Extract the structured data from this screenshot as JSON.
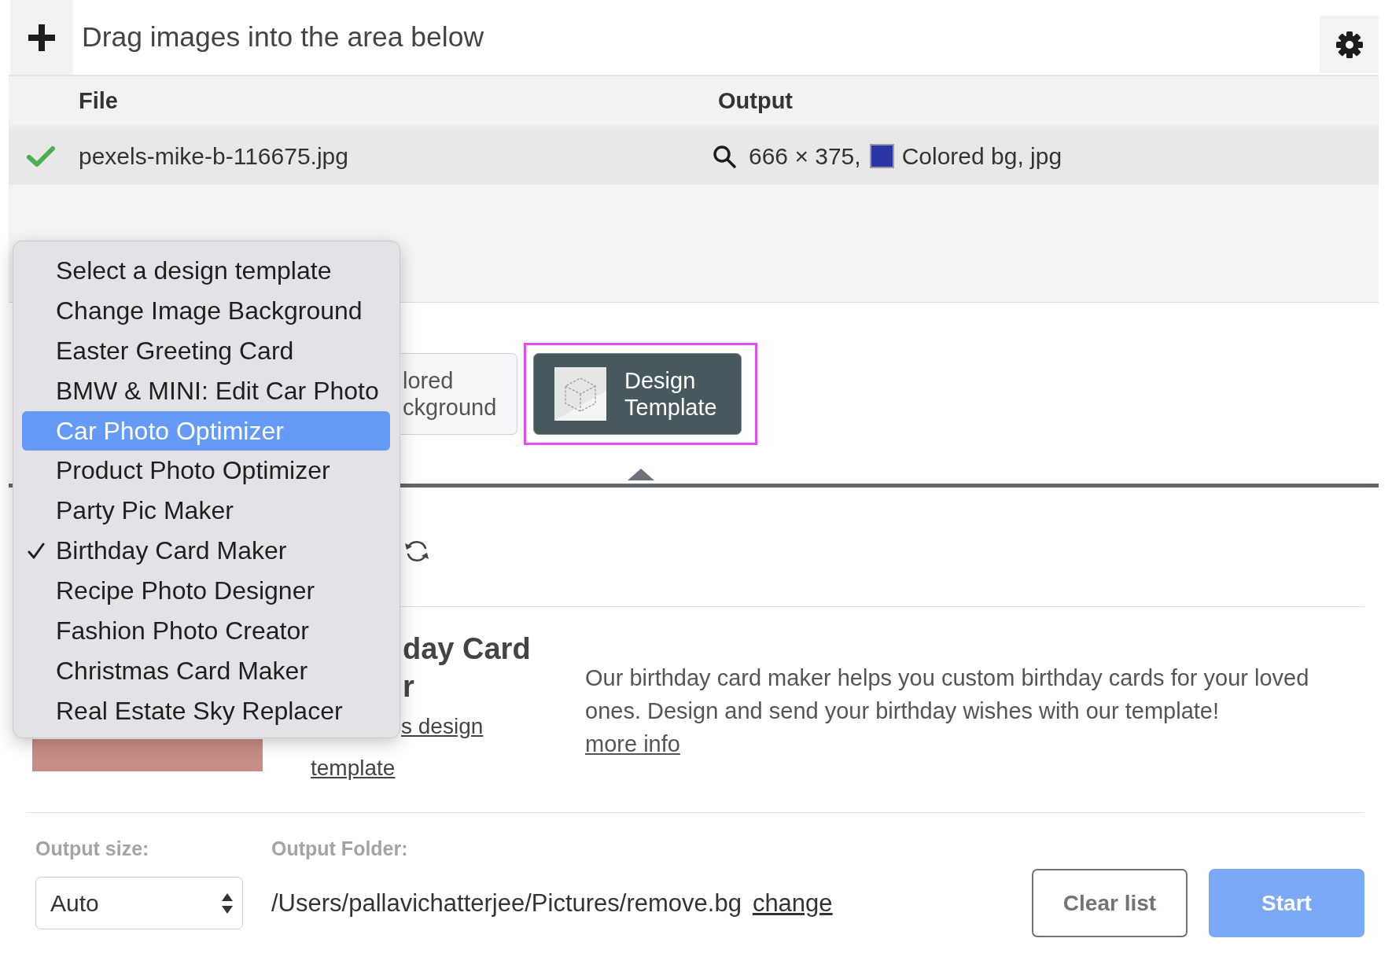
{
  "toolbar": {
    "drop_hint": "Drag images into the area below"
  },
  "file_table": {
    "columns": [
      "File",
      "Output"
    ],
    "rows": [
      {
        "done": true,
        "file": "pexels-mike-b-116675.jpg",
        "dimensions": "666 × 375,",
        "color": "#2b35a6",
        "output": "Colored bg, jpg"
      }
    ]
  },
  "mode_buttons": [
    {
      "kind": "colored",
      "label_lines": [
        "lored",
        "ckground"
      ],
      "selected": false
    },
    {
      "kind": "template",
      "label_lines": [
        "Design",
        "Template"
      ],
      "selected": true
    }
  ],
  "template_menu": {
    "items": [
      {
        "label": "Select a design template",
        "checked": false,
        "highlighted": false
      },
      {
        "label": "Change Image Background",
        "checked": false,
        "highlighted": false
      },
      {
        "label": "Easter Greeting Card",
        "checked": false,
        "highlighted": false
      },
      {
        "label": "BMW & MINI: Edit Car Photo",
        "checked": false,
        "highlighted": false
      },
      {
        "label": "Car Photo Optimizer",
        "checked": false,
        "highlighted": true
      },
      {
        "label": "Product Photo Optimizer",
        "checked": false,
        "highlighted": false
      },
      {
        "label": "Party Pic Maker",
        "checked": false,
        "highlighted": false
      },
      {
        "label": "Birthday Card Maker",
        "checked": true,
        "highlighted": false
      },
      {
        "label": "Recipe Photo Designer",
        "checked": false,
        "highlighted": false
      },
      {
        "label": "Fashion Photo Creator",
        "checked": false,
        "highlighted": false
      },
      {
        "label": "Christmas Card Maker",
        "checked": false,
        "highlighted": false
      },
      {
        "label": "Real Estate Sky Replacer",
        "checked": false,
        "highlighted": false
      }
    ]
  },
  "template_card": {
    "title_lines": [
      "day Card",
      "r"
    ],
    "link_lines": [
      "s design",
      "template"
    ],
    "description": "Our birthday card maker helps you custom birthday cards for your loved ones. Design and send your birthday wishes with our template!",
    "more_info": "more info"
  },
  "output_settings": {
    "size_label": "Output size:",
    "size": "Auto",
    "folder_label": "Output Folder:",
    "folder": "/Users/pallavichatterjee/Pictures/remove.bg",
    "change": "change"
  },
  "buttons": [
    {
      "label": "Clear list",
      "kind": "outline"
    },
    {
      "label": "Start",
      "kind": "primary"
    }
  ]
}
